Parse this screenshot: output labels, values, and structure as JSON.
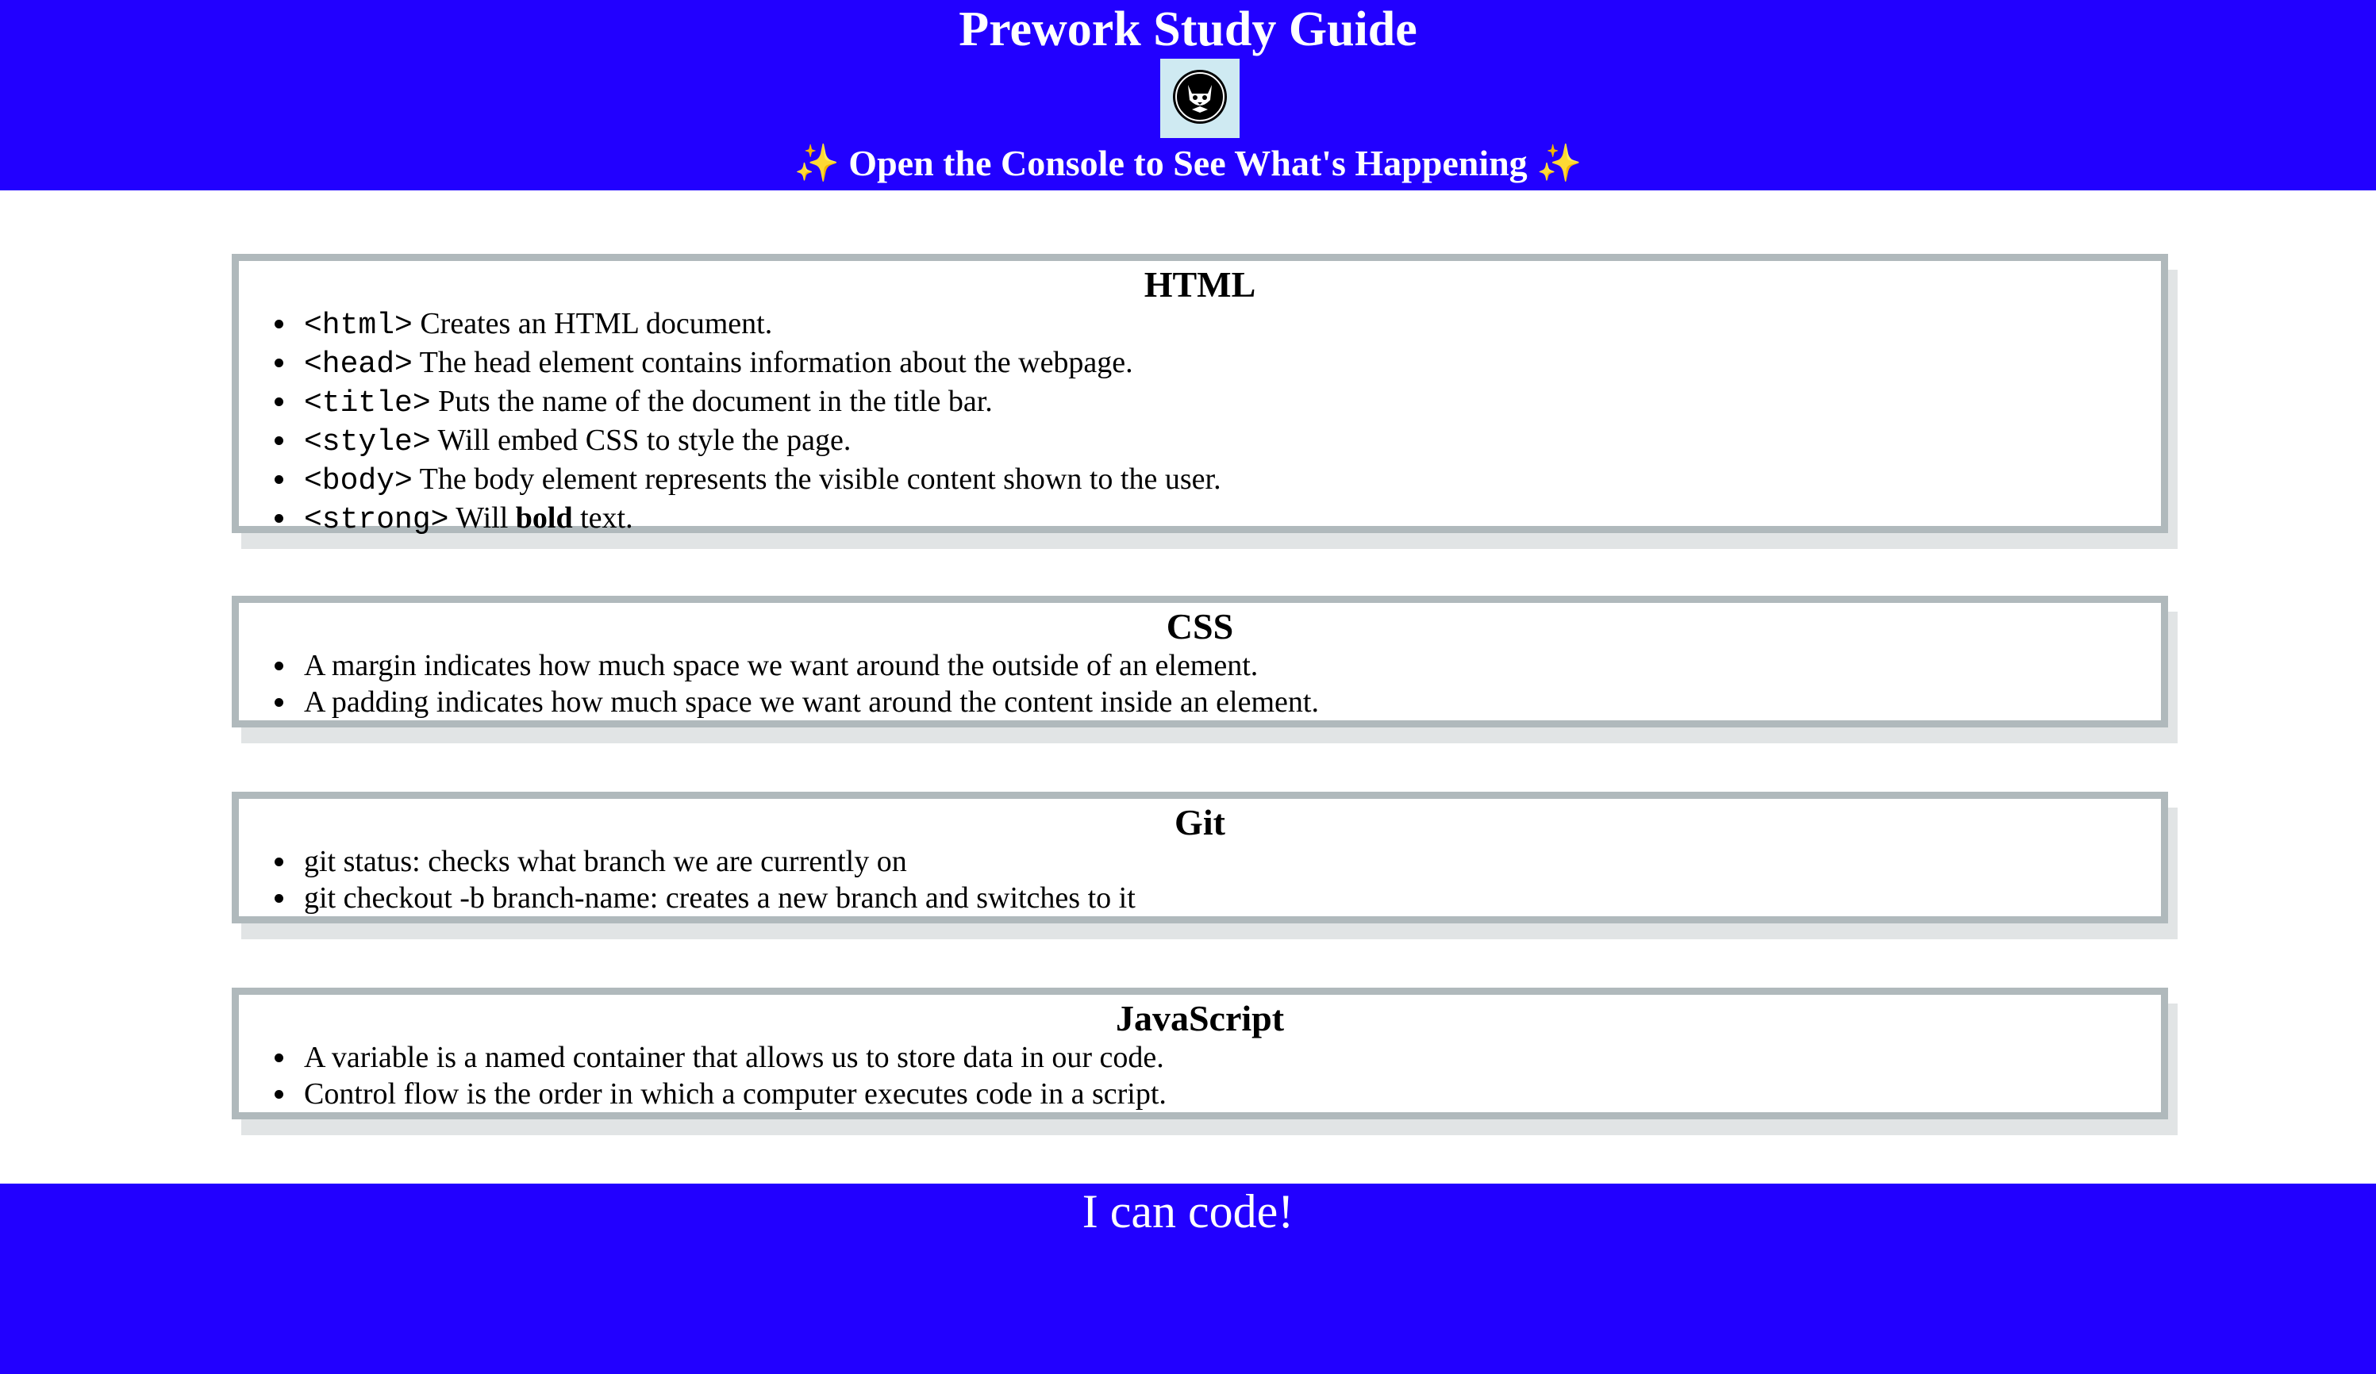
{
  "colors": {
    "accent": "#2200ff",
    "card_border": "#b0b9bc",
    "card_shadow": "#e1e4e5",
    "text_light": "#ffffff"
  },
  "header": {
    "title": "Prework Study Guide",
    "logo_icon": "cat-logo-icon",
    "subtitle": {
      "sparkle_left": "✨",
      "text": "Open the Console to See What's Happening",
      "sparkle_right": "✨"
    }
  },
  "sections": {
    "html": {
      "title": "HTML",
      "items": [
        {
          "code": "<html>",
          "text": "Creates an HTML document."
        },
        {
          "code": "<head>",
          "text": "The head element contains information about the webpage."
        },
        {
          "code": "<title>",
          "text": "Puts the name of the document in the title bar."
        },
        {
          "code": "<style>",
          "text": "Will embed CSS to style the page."
        },
        {
          "code": "<body>",
          "text": "The body element represents the visible content shown to the user."
        },
        {
          "code": "<strong>",
          "prefix": "Will",
          "bold": "bold",
          "suffix": "text."
        }
      ]
    },
    "css": {
      "title": "CSS",
      "items": [
        "A margin indicates how much space we want around the outside of an element.",
        "A padding indicates how much space we want around the content inside an element."
      ]
    },
    "git": {
      "title": "Git",
      "items": [
        "git status: checks what branch we are currently on",
        "git checkout -b branch-name: creates a new branch and switches to it"
      ]
    },
    "javascript": {
      "title": "JavaScript",
      "items": [
        "A variable is a named container that allows us to store data in our code.",
        "Control flow is the order in which a computer executes code in a script."
      ]
    }
  },
  "footer": {
    "text": "I can code!"
  }
}
